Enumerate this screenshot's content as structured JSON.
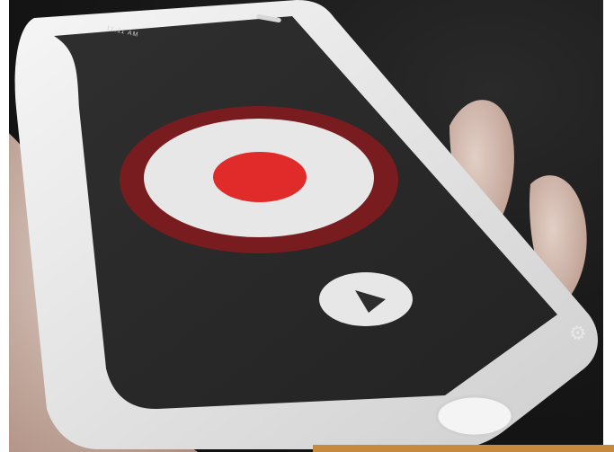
{
  "status_bar": {
    "time": "11:11 AM"
  },
  "controls": {
    "record_icon": "record-icon",
    "play_icon": "play-icon",
    "settings_icon": "gear-icon"
  },
  "colors": {
    "screen": "#2b2b2b",
    "record_ring": "#7c1b1f",
    "record_disc": "#e7e7e7",
    "record_dot": "#e12b2b",
    "phone_body": "#e6e6e6",
    "skin": "#d2b7aa"
  }
}
